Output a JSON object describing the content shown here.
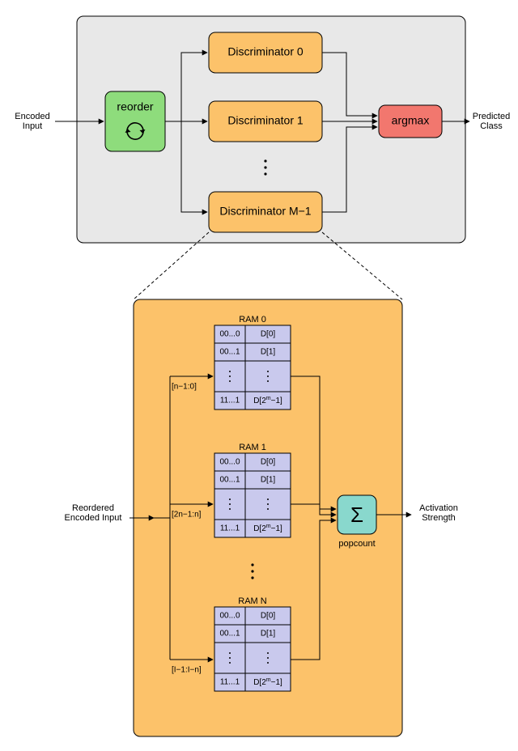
{
  "top": {
    "input_label": "Encoded\nInput",
    "output_label": "Predicted\nClass",
    "reorder_label": "reorder",
    "disc0": "Discriminator 0",
    "disc1": "Discriminator 1",
    "discM": "Discriminator M−1",
    "argmax": "argmax"
  },
  "bottom": {
    "input_label": "Reordered\nEncoded Input",
    "output_label": "Activation\nStrength",
    "sum_label": "popcount",
    "ram0_title": "RAM 0",
    "ram1_title": "RAM 1",
    "ramN_title": "RAM N",
    "slice0": "[n−1:0]",
    "slice1": "[2n−1:n]",
    "sliceN": "[I−1:I−n]",
    "row_addr0": "00...0",
    "row_addr1": "00...1",
    "row_addrLast": "11...1",
    "row_data0": "D[0]",
    "row_data1": "D[1]",
    "row_dataLast_pre": "D[2",
    "row_dataLast_sup": "m",
    "row_dataLast_post": "−1]"
  },
  "colors": {
    "grey_panel": "#e8e8e8",
    "green": "#8edc7c",
    "orange": "#fcc26a",
    "red": "#f2776e",
    "purple": "#c9c9ed",
    "teal": "#89d8cd"
  }
}
